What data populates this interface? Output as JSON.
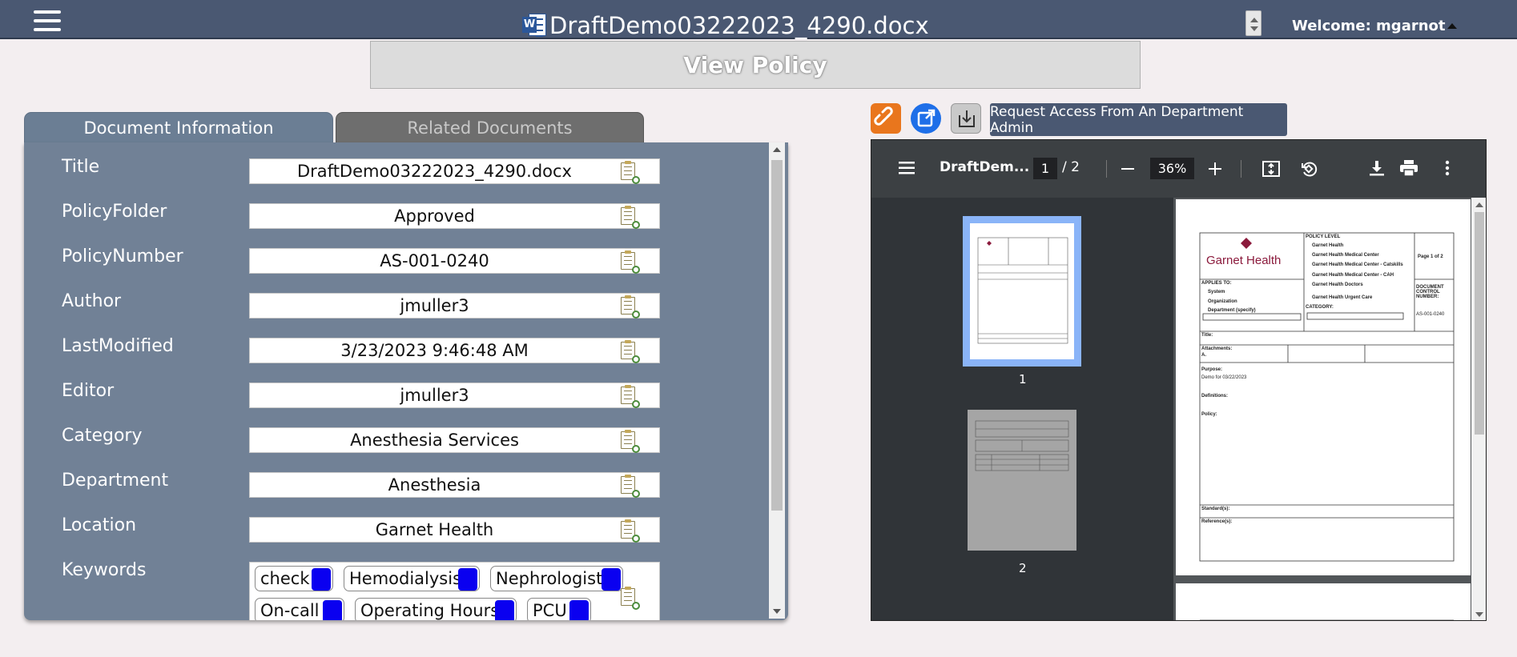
{
  "topbar": {
    "filename": "DraftDemo03222023_4290.docx",
    "welcome": "Welcome: mgarnot"
  },
  "view_policy_label": "View Policy",
  "tabs": {
    "info": "Document Information",
    "related": "Related Documents"
  },
  "fields": {
    "title": {
      "label": "Title",
      "value": "DraftDemo03222023_4290.docx"
    },
    "folder": {
      "label": "PolicyFolder",
      "value": "Approved"
    },
    "number": {
      "label": "PolicyNumber",
      "value": "AS-001-0240"
    },
    "author": {
      "label": "Author",
      "value": "jmuller3"
    },
    "modified": {
      "label": "LastModified",
      "value": "3/23/2023 9:46:48 AM"
    },
    "editor": {
      "label": "Editor",
      "value": "jmuller3"
    },
    "category": {
      "label": "Category",
      "value": "Anesthesia Services"
    },
    "department": {
      "label": "Department",
      "value": "Anesthesia"
    },
    "location": {
      "label": "Location",
      "value": "Garnet Health"
    },
    "keywords_label": "Keywords"
  },
  "keywords": [
    "check",
    "Hemodialysis",
    "Nephrologist",
    "On-call",
    "Operating Hours",
    "PCU"
  ],
  "request_access_label": "Request Access From An Department Admin",
  "pdf_viewer": {
    "title": "DraftDem...",
    "page_current": "1",
    "page_total": "/  2",
    "zoom": "36%",
    "thumb_labels": [
      "1",
      "2"
    ]
  },
  "pdf_page": {
    "logo_text": "Garnet Health",
    "policy_level": "POLICY LEVEL",
    "levels": [
      "Garnet Health",
      "Garnet Health Medical Center",
      "Garnet Health Medical Center - Catskills",
      "Garnet Health Medical Center - CAH",
      "Garnet Health Doctors",
      "Garnet Health Urgent Care"
    ],
    "page_of": "Page 1 of 2",
    "applies_to": "APPLIES TO:",
    "applies": [
      "System",
      "Organization",
      "Department (specify)"
    ],
    "doc_control": "DOCUMENT CONTROL NUMBER:",
    "doc_number": "AS-001-0240",
    "category": "CATEGORY:",
    "title": "Title:",
    "attachments": "Attachments:",
    "attachments_a": "A.",
    "purpose": "Purpose:",
    "purpose_text": "Demo for 03/22/2023",
    "definitions": "Definitions:",
    "policy": "Policy:",
    "standards": "Standard(s):",
    "references": "Reference(s):"
  },
  "colors": {
    "topbar": "#4a5872",
    "panel": "#718196",
    "link_button": "#e9761d",
    "external_button": "#1e6fe8",
    "keyword_remove": "#0a00f0"
  }
}
